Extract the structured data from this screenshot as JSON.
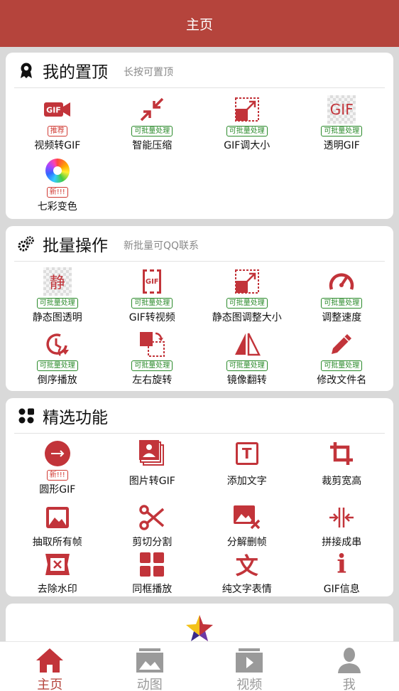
{
  "header": {
    "title": "主页"
  },
  "colors": {
    "brand": "#b5443c",
    "badge_green": "#2a8a2a",
    "badge_red": "#d03a33"
  },
  "pinned": {
    "title": "我的置顶",
    "subtitle": "长按可置顶",
    "items": [
      {
        "label": "视频转GIF",
        "badge": "推荐",
        "icon": "video-gif-icon"
      },
      {
        "label": "智能压缩",
        "badge": "可批量处理",
        "icon": "compress-icon"
      },
      {
        "label": "GIF调大小",
        "badge": "可批量处理",
        "icon": "resize-icon"
      },
      {
        "label": "透明GIF",
        "badge": "可批量处理",
        "icon": "transparent-gif-icon",
        "icon_text": "GIF"
      },
      {
        "label": "七彩变色",
        "badge": "新!!!",
        "icon": "color-wheel-icon"
      }
    ]
  },
  "batch": {
    "title": "批量操作",
    "subtitle": "新批量可QQ联系",
    "items": [
      {
        "label": "静态图透明",
        "badge": "可批量处理",
        "icon": "static-transparent-icon",
        "icon_text": "静"
      },
      {
        "label": "GIF转视频",
        "badge": "可批量处理",
        "icon": "gif-to-video-icon",
        "icon_text": "GIF"
      },
      {
        "label": "静态图调整大小",
        "badge": "可批量处理",
        "icon": "static-resize-icon"
      },
      {
        "label": "调整速度",
        "badge": "可批量处理",
        "icon": "speed-gauge-icon"
      },
      {
        "label": "倒序播放",
        "badge": "可批量处理",
        "icon": "reverse-play-icon"
      },
      {
        "label": "左右旋转",
        "badge": "可批量处理",
        "icon": "rotate-icon"
      },
      {
        "label": "镜像翻转",
        "badge": "可批量处理",
        "icon": "mirror-flip-icon"
      },
      {
        "label": "修改文件名",
        "badge": "可批量处理",
        "icon": "pencil-icon"
      }
    ]
  },
  "featured": {
    "title": "精选功能",
    "items": [
      {
        "label": "圆形GIF",
        "badge": "新!!!",
        "icon": "circle-gif-icon"
      },
      {
        "label": "图片转GIF",
        "icon": "images-to-gif-icon"
      },
      {
        "label": "添加文字",
        "icon": "add-text-icon",
        "icon_text": "T"
      },
      {
        "label": "裁剪宽高",
        "icon": "crop-icon"
      },
      {
        "label": "抽取所有帧",
        "icon": "extract-frames-icon"
      },
      {
        "label": "剪切分割",
        "icon": "scissors-icon"
      },
      {
        "label": "分解删帧",
        "icon": "delete-frame-icon"
      },
      {
        "label": "拼接成串",
        "icon": "join-icon"
      },
      {
        "label": "去除水印",
        "icon": "remove-watermark-icon"
      },
      {
        "label": "同框播放",
        "icon": "grid-play-icon"
      },
      {
        "label": "纯文字表情",
        "icon": "text-emoji-icon",
        "icon_text": "文"
      },
      {
        "label": "GIF信息",
        "icon": "info-icon",
        "icon_text": "i"
      }
    ]
  },
  "nav": [
    {
      "label": "主页",
      "icon": "home-icon",
      "active": true
    },
    {
      "label": "动图",
      "icon": "gallery-icon",
      "active": false
    },
    {
      "label": "视频",
      "icon": "video-icon",
      "active": false
    },
    {
      "label": "我",
      "icon": "user-icon",
      "active": false
    }
  ]
}
